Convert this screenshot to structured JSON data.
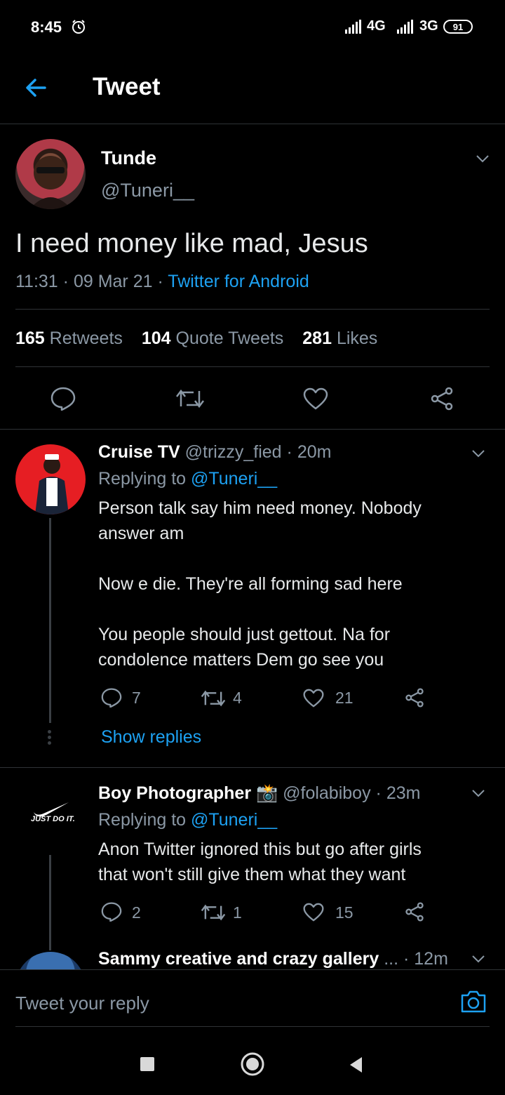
{
  "status": {
    "time": "8:45",
    "net1": "4G",
    "net2": "3G",
    "battery": "91"
  },
  "header": {
    "title": "Tweet"
  },
  "tweet": {
    "name": "Tunde",
    "handle": "@Tuneri__",
    "text": "I need money like mad, Jesus",
    "time": "11:31",
    "date": "09 Mar 21",
    "source": "Twitter for Android",
    "retweets": "165",
    "retweets_label": "Retweets",
    "quotes": "104",
    "quotes_label": "Quote Tweets",
    "likes": "281",
    "likes_label": "Likes"
  },
  "replies": [
    {
      "name": "Cruise TV",
      "handle": "@trizzy_fied",
      "time": "20m",
      "replying_label": "Replying to",
      "replying_to": "@Tuneri__",
      "lines": [
        "Person talk say him need money. Nobody",
        "answer am",
        "Now e die. They're all forming sad here",
        "You people should just gettout. Na for",
        "condolence matters Dem go see you"
      ],
      "reply_count": "7",
      "retweet_count": "4",
      "like_count": "21",
      "show_replies": "Show replies"
    },
    {
      "name": "Boy Photographer",
      "emoji": "📸",
      "handle": "@folabiboy",
      "time": "23m",
      "avatar_text": "JUST DO IT.",
      "replying_label": "Replying to",
      "replying_to": "@Tuneri__",
      "lines": [
        "Anon Twitter ignored this but go after girls",
        "that won't still give them what they want"
      ],
      "reply_count": "2",
      "retweet_count": "1",
      "like_count": "15"
    },
    {
      "name": "Sammy creative and crazy gallery",
      "ellipsis": "...",
      "time": "12m"
    }
  ],
  "compose": {
    "placeholder": "Tweet your reply"
  },
  "colors": {
    "accent": "#1da1f2",
    "muted": "#8b98a5",
    "divider": "#2f3336"
  }
}
